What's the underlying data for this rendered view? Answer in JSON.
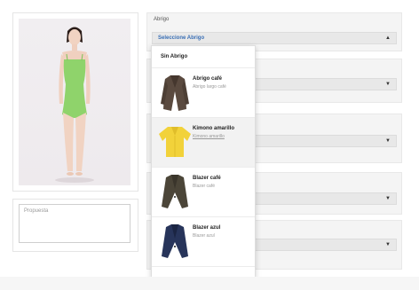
{
  "proposal": {
    "label": "Propuesta"
  },
  "coat_section": {
    "title": "Abrigo",
    "select_value": "Seleccione Abrigo",
    "options": [
      {
        "name": "Sin Abrigo"
      },
      {
        "name": "Abrigo café",
        "subtitle": "Abrigo largo café",
        "icon": "brown-long-coat-icon",
        "color": "#5a4a3f"
      },
      {
        "name": "Kimono amarillo",
        "subtitle": "Kimono amarillo",
        "icon": "yellow-kimono-icon",
        "color": "#f2d23a",
        "selected": true
      },
      {
        "name": "Blazer café",
        "subtitle": "Blazer café",
        "icon": "brown-blazer-icon",
        "color": "#4b4538"
      },
      {
        "name": "Blazer azul",
        "subtitle": "Blazer azul",
        "icon": "navy-blazer-icon",
        "color": "#27345a"
      }
    ]
  },
  "colors": {
    "link": "#3a6fb5",
    "panel": "#f4f4f4",
    "select": "#e8e8e8"
  }
}
